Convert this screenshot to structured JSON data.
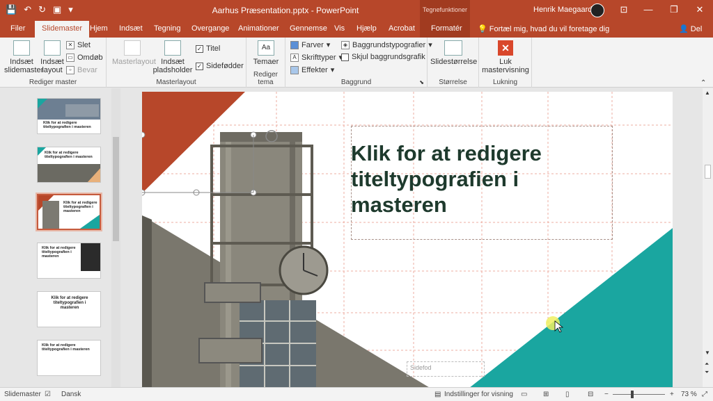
{
  "app": {
    "doc_title": "Aarhus Præsentation.pptx  -  PowerPoint",
    "context_group": "Tegnefunktioner",
    "user_name": "Henrik Maegaard"
  },
  "tabs": {
    "items": [
      "Filer",
      "Slidemaster",
      "Hjem",
      "Indsæt",
      "Tegning",
      "Overgange",
      "Animationer",
      "Gennemse",
      "Vis",
      "Hjælp",
      "Acrobat",
      "Formatér"
    ],
    "tell_me": "Fortæl mig, hvad du vil foretage dig",
    "share": "Del"
  },
  "ribbon": {
    "rediger_master": {
      "label": "Rediger master",
      "insert_slidemaster": "Indsæt slidemaster",
      "insert_layout": "Indsæt layout",
      "delete": "Slet",
      "rename": "Omdøb",
      "preserve": "Bevar"
    },
    "masterlayout": {
      "label": "Masterlayout",
      "masterlayout_btn": "Masterlayout",
      "insert_placeholder": "Indsæt pladsholder",
      "title_chk": "Titel",
      "footers_chk": "Sidefødder"
    },
    "rediger_tema": {
      "label": "Rediger tema",
      "themes": "Temaer"
    },
    "baggrund": {
      "label": "Baggrund",
      "colors": "Farver",
      "fonts": "Skrifttyper",
      "effects": "Effekter",
      "bg_styles": "Baggrundstypografier",
      "hide_bg": "Skjul baggrundsgrafik"
    },
    "storrelse": {
      "label": "Størrelse",
      "slide_size": "Slidestørrelse"
    },
    "lukning": {
      "label": "Lukning",
      "close_master": "Luk mastervisning"
    }
  },
  "thumbnails": [
    {
      "title": "Klik for at redigere titeltypografien i masteren",
      "variant": "photo-top"
    },
    {
      "title": "Klik for at redigere titeltypografien i masteren",
      "variant": "photo-bottom"
    },
    {
      "title": "Klik for at redigere titeltypografien i masteren",
      "variant": "tower",
      "selected": true
    },
    {
      "title": "Klik for at redigere titeltypografien i masteren",
      "variant": "right-dark"
    },
    {
      "title": "Klik for at redigere titeltypografien i masteren",
      "variant": "center"
    },
    {
      "title": "Klik for at redigere titeltypografien i masteren",
      "variant": "content"
    }
  ],
  "slide": {
    "title": "Klik for at redigere titeltypografien i masteren",
    "footer_placeholder": "Sidefod",
    "colors": {
      "accent_red": "#b7472a",
      "accent_teal": "#1aa6a0",
      "title_color": "#1e3a2d"
    }
  },
  "status": {
    "view": "Slidemaster",
    "language": "Dansk",
    "display_settings": "Indstillinger for visning",
    "zoom": "73 %"
  }
}
